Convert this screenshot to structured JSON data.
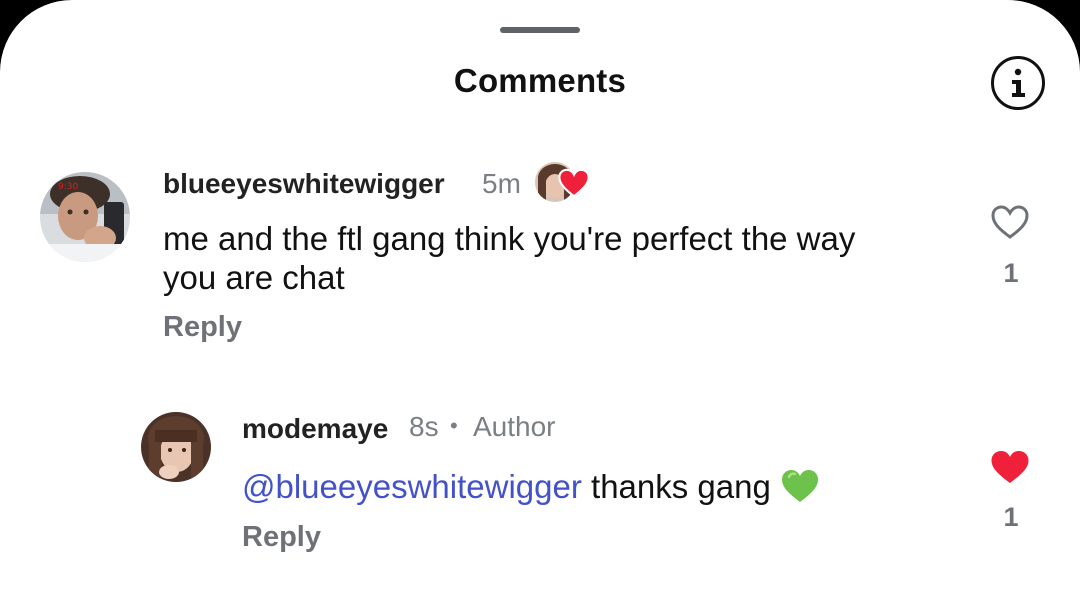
{
  "header": {
    "title": "Comments"
  },
  "comments": [
    {
      "username": "blueeyeswhitewigger",
      "time": "5m",
      "text": "me and the ftl gang think you're perfect the way you are chat",
      "reply_label": "Reply",
      "like_count": "1",
      "liked": false,
      "liked_by_creator": true
    }
  ],
  "replies": [
    {
      "username": "modemaye",
      "time": "8s",
      "separator": "•",
      "author_label": "Author",
      "mention": "@blueeyeswhitewigger",
      "text": " thanks gang",
      "emoji": "💚",
      "reply_label": "Reply",
      "like_count": "1",
      "liked": true
    }
  ],
  "colors": {
    "mention": "#4452c9",
    "like_active": "#f0203a",
    "emoji_green": "#6cc24a"
  },
  "icons": [
    "info-icon",
    "heart-outline-icon",
    "heart-filled-icon"
  ]
}
